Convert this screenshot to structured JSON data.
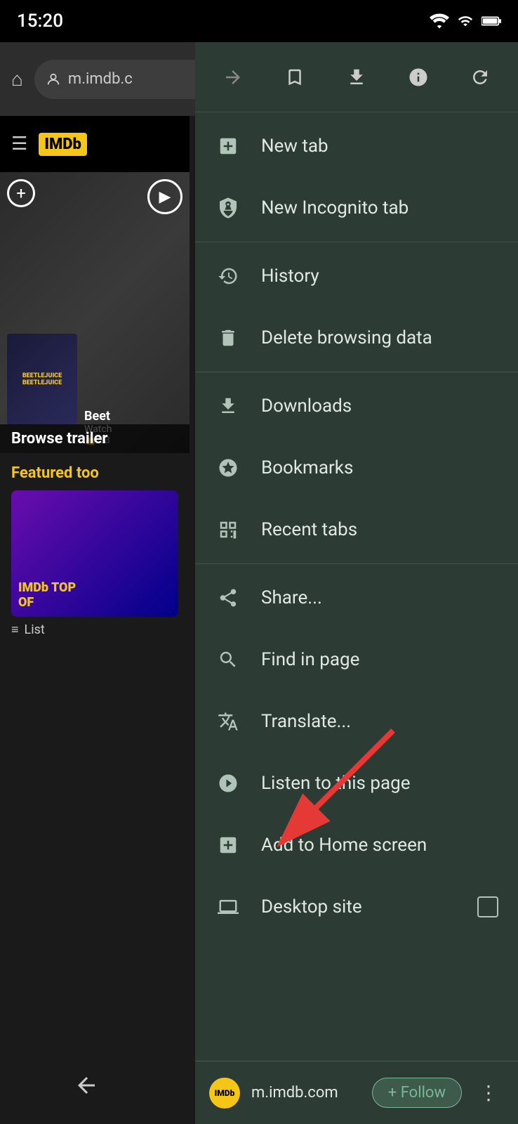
{
  "statusBar": {
    "time": "15:20"
  },
  "addressBar": {
    "url": "m.imdb.c"
  },
  "background": {
    "imdbLogo": "IMDb",
    "movieTitle": "Beet",
    "movieSubtitle": "Watch",
    "browseTrailers": "Browse trailer",
    "featuredToday": "Featured too",
    "listLabel": "List"
  },
  "menu": {
    "toolbar": {
      "forward": "→",
      "bookmark": "☆",
      "download": "⬇",
      "info": "ⓘ",
      "refresh": "↻"
    },
    "items": [
      {
        "id": "new-tab",
        "icon": "➕",
        "label": "New tab",
        "iconType": "new-tab-icon"
      },
      {
        "id": "new-incognito-tab",
        "icon": "🕵",
        "label": "New Incognito tab",
        "iconType": "incognito-icon"
      },
      {
        "id": "divider1"
      },
      {
        "id": "history",
        "icon": "🕐",
        "label": "History",
        "iconType": "history-icon"
      },
      {
        "id": "delete-browsing-data",
        "icon": "🗑",
        "label": "Delete browsing data",
        "iconType": "delete-icon"
      },
      {
        "id": "divider2"
      },
      {
        "id": "downloads",
        "icon": "⬇",
        "label": "Downloads",
        "iconType": "downloads-icon"
      },
      {
        "id": "bookmarks",
        "icon": "★",
        "label": "Bookmarks",
        "iconType": "bookmarks-icon"
      },
      {
        "id": "recent-tabs",
        "icon": "▣",
        "label": "Recent tabs",
        "iconType": "recent-tabs-icon"
      },
      {
        "id": "divider3"
      },
      {
        "id": "share",
        "icon": "⎘",
        "label": "Share...",
        "iconType": "share-icon"
      },
      {
        "id": "find-in-page",
        "icon": "🔍",
        "label": "Find in page",
        "iconType": "find-icon"
      },
      {
        "id": "translate",
        "icon": "G",
        "label": "Translate...",
        "iconType": "translate-icon"
      },
      {
        "id": "listen-to-page",
        "icon": "▶",
        "label": "Listen to this page",
        "iconType": "listen-icon"
      },
      {
        "id": "add-to-home",
        "icon": "⬡",
        "label": "Add to Home screen",
        "iconType": "add-home-icon"
      },
      {
        "id": "desktop-site",
        "icon": "🖥",
        "label": "Desktop site",
        "iconType": "desktop-icon",
        "hasCheckbox": true
      }
    ],
    "followBar": {
      "siteIcon": "IMDb",
      "siteUrl": "m.imdb.com",
      "followLabel": "+ Follow"
    }
  },
  "navBar": {
    "back": "◀",
    "home": "⬤",
    "recent": "■"
  }
}
